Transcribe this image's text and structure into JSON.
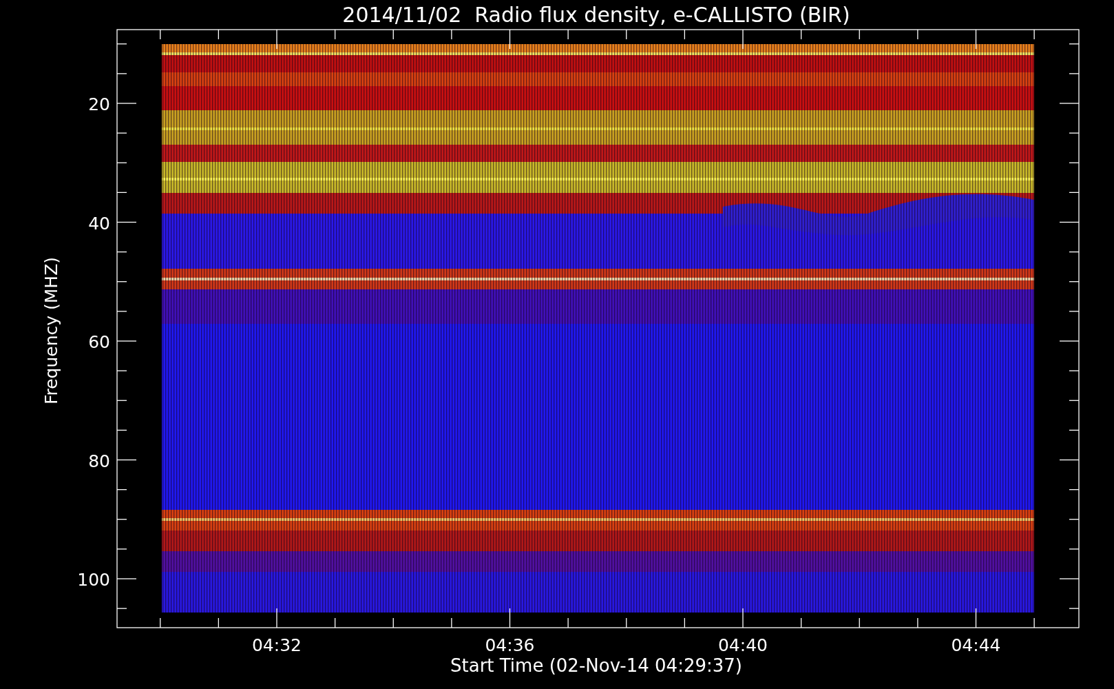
{
  "plot": {
    "title": "2014/11/02  Radio flux density, e-CALLISTO (BIR)",
    "x_axis": {
      "label": "Start Time (02-Nov-14 04:29:37)",
      "ticks": [
        "04:32",
        "04:36",
        "04:40",
        "04:44"
      ]
    },
    "y_axis": {
      "label": "Frequency (MHZ)",
      "ticks": [
        "20",
        "40",
        "60",
        "80",
        "100"
      ]
    }
  }
}
